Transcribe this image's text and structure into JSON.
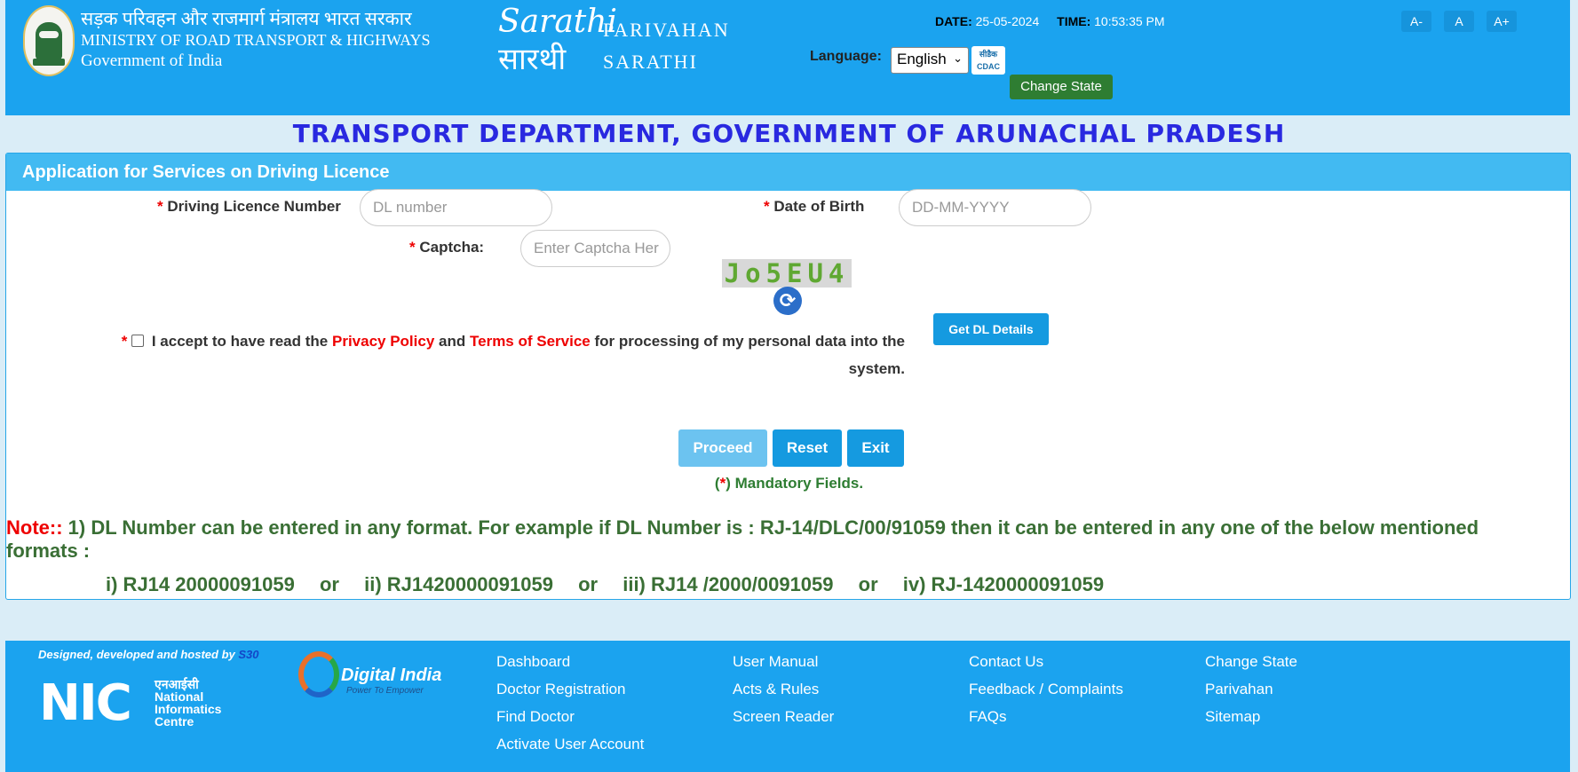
{
  "header": {
    "ministry_hindi": "सड़क परिवहन और राजमार्ग मंत्रालय भारत सरकार",
    "ministry_english": "MINISTRY OF ROAD TRANSPORT & HIGHWAYS",
    "government": "Government of India",
    "sarathi_logo_en": "Sarathi",
    "sarathi_logo_hi": "सारथी",
    "parivahan": "PARIVAHAN",
    "sarathi": "SARATHI",
    "date_label": "DATE:",
    "date_value": "25-05-2024",
    "time_label": "TIME:",
    "time_value": "10:53:35 PM",
    "language_label": "Language:",
    "language_selected": "English",
    "cdac_hi": "सीडैक",
    "cdac_en": "CDAC",
    "change_state": "Change State",
    "font_decrease": "A-",
    "font_normal": "A",
    "font_increase": "A+"
  },
  "department_title": "TRANSPORT DEPARTMENT, GOVERNMENT OF ARUNACHAL PRADESH",
  "form": {
    "panel_title": "Application for Services on Driving Licence",
    "required_mark": "*",
    "dl_label": "Driving Licence Number",
    "dl_placeholder": "DL number",
    "dob_label": "Date of Birth",
    "dob_placeholder": "DD-MM-YYYY",
    "captcha_label": "Captcha:",
    "captcha_placeholder": "Enter Captcha Her",
    "captcha_text": "Jo5EU4",
    "consent_pre": "I accept to have read the",
    "privacy_policy": "Privacy Policy",
    "and": "and",
    "terms": "Terms of Service",
    "consent_post": "for processing of my personal data into the system.",
    "get_dl_details": "Get DL Details",
    "proceed": "Proceed",
    "reset": "Reset",
    "exit": "Exit",
    "mandatory_open": "(",
    "mandatory_close": ") Mandatory Fields.",
    "note_label": "Note::",
    "note_text": "1) DL Number can be entered in any format. For example if DL Number is : RJ-14/DLC/00/91059 then it can be entered in any one of the below mentioned formats :",
    "formats": [
      "i) RJ14 20000091059",
      "or",
      "ii) RJ1420000091059",
      "or",
      "iii) RJ14 /2000/0091059",
      "or",
      "iv) RJ-1420000091059"
    ]
  },
  "footer": {
    "designed_by": "Designed, developed and hosted by",
    "designed_by_s3": "S30",
    "nic_short": "NIC",
    "nic_hindi": "एनआईसी",
    "nic_line1": "National",
    "nic_line2": "Informatics",
    "nic_line3": "Centre",
    "digital_india": "Digital India",
    "digital_india_tag": "Power To Empower",
    "links": [
      [
        "Dashboard",
        "User Manual",
        "Contact Us",
        "Change State"
      ],
      [
        "Doctor Registration",
        "Acts & Rules",
        "Feedback / Complaints",
        "Parivahan"
      ],
      [
        "Find Doctor",
        "Screen Reader",
        "FAQs",
        "Sitemap"
      ],
      [
        "Activate User Account",
        "",
        "",
        ""
      ]
    ]
  }
}
